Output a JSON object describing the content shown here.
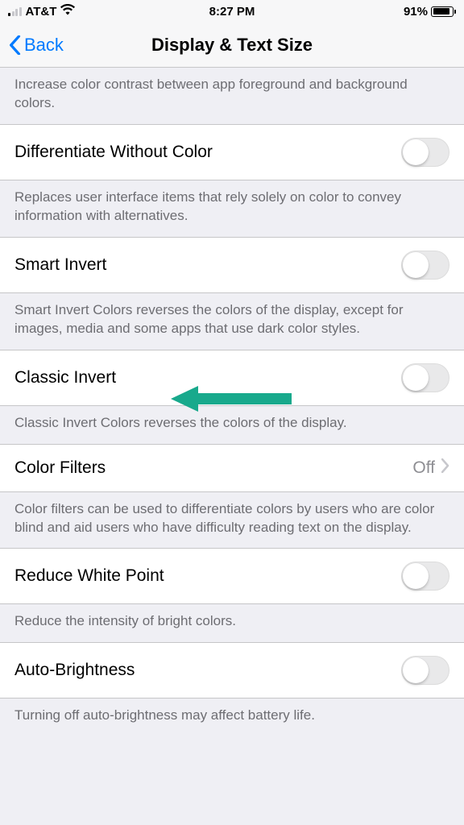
{
  "status_bar": {
    "carrier": "AT&T",
    "time": "8:27 PM",
    "battery_percent": "91%"
  },
  "nav": {
    "back_label": "Back",
    "title": "Display & Text Size"
  },
  "sections": {
    "contrast_footer": "Increase color contrast between app foreground and background colors.",
    "differentiate": {
      "label": "Differentiate Without Color",
      "footer": "Replaces user interface items that rely solely on color to convey information with alternatives."
    },
    "smart_invert": {
      "label": "Smart Invert",
      "footer": "Smart Invert Colors reverses the colors of the display, except for images, media and some apps that use dark color styles."
    },
    "classic_invert": {
      "label": "Classic Invert",
      "footer": "Classic Invert Colors reverses the colors of the display."
    },
    "color_filters": {
      "label": "Color Filters",
      "value": "Off",
      "footer": "Color filters can be used to differentiate colors by users who are color blind and aid users who have difficulty reading text on the display."
    },
    "reduce_white_point": {
      "label": "Reduce White Point",
      "footer": "Reduce the intensity of bright colors."
    },
    "auto_brightness": {
      "label": "Auto-Brightness",
      "footer": "Turning off auto-brightness may affect battery life."
    }
  }
}
